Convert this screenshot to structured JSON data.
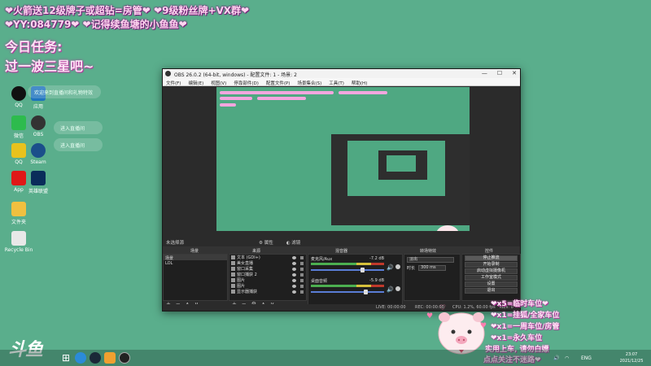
{
  "overlay": {
    "line1": "❤火箭送12级牌子或超钻=房管❤  ❤9级粉丝牌+VX群❤",
    "line2": "❤YY:084779❤  ❤记得续鱼塘的小鱼鱼❤",
    "task_title": "今日任务:",
    "task_body": "过一波三星吧~"
  },
  "desktop": {
    "icons": [
      {
        "label": "QQ",
        "color": "#111"
      },
      {
        "label": "应用",
        "color": "#1e73be"
      },
      {
        "label": "微信",
        "color": "#2dbb4d"
      },
      {
        "label": "OBS",
        "color": "#333"
      },
      {
        "label": "QQ",
        "color": "#e8c21d"
      },
      {
        "label": "Steam",
        "color": "#1b4f8a"
      },
      {
        "label": "App",
        "color": "#e01818"
      },
      {
        "label": "英雄联盟",
        "color": "#0a2c5a"
      },
      {
        "label": "文件夹",
        "color": "#f0c040"
      },
      {
        "label": "Recycle Bin",
        "color": "#e8e8e8"
      }
    ],
    "chat": [
      "欢迎来到直播间和礼物特效",
      "进入直播间",
      "进入直播间"
    ]
  },
  "obs": {
    "title": "OBS 26.0.2 (64-bit, windows) - 配置文件: 1 - 场景: 2",
    "window_controls": [
      "—",
      "☐",
      "✕"
    ],
    "menu": [
      "文件(F)",
      "编辑(E)",
      "视图(V)",
      "停靠部件(D)",
      "配置文件(P)",
      "场景集合(S)",
      "工具(T)",
      "帮助(H)"
    ],
    "no_source": "未选择源",
    "props_label": "属性",
    "filters_label": "滤镜",
    "docks": {
      "scenes": "场景",
      "sources": "来源",
      "mixer": "混音器",
      "transitions": "转场特效",
      "controls": "控件"
    },
    "scenes": [
      "场景",
      "LOL"
    ],
    "sources": [
      "文本 (GDI+)",
      "美女直播",
      "窗口采集",
      "窗口捕获 2",
      "图片",
      "图片",
      "显示器捕获"
    ],
    "mixer": [
      {
        "name": "麦克风/Aux",
        "db": "-7.2 dB",
        "vol": 0.68
      },
      {
        "name": "桌面音频",
        "db": "-5.9 dB",
        "vol": 0.72
      }
    ],
    "transition": {
      "type": "淡出",
      "duration_label": "时长",
      "duration": "300 ms"
    },
    "controls": [
      "停止推流",
      "开始录制",
      "启动虚拟摄像机",
      "工作室模式",
      "设置",
      "退出"
    ],
    "status": {
      "live": "LIVE: 00:00:00",
      "rec": "REC: 00:00:00",
      "cpu": "CPU: 1.2%, 60.00 fps",
      "kbps": "kb/s: 0"
    }
  },
  "preview": {
    "logo": "斗鱼"
  },
  "rewards": [
    "❤x5=临时车位❤",
    "❤x1=挂狐/全家车位",
    "❤x1=一周车位/房管",
    "❤x1=永久车位",
    "实用上车, 请勿白嫖",
    "点点关注不迷路❤"
  ],
  "brand": "斗鱼",
  "taskbar": {
    "apps": [
      {
        "name": "windows-icon",
        "color": "#ffffff"
      },
      {
        "name": "edge-icon",
        "color": "#2b8bd8"
      },
      {
        "name": "steam-icon",
        "color": "#1b2838"
      },
      {
        "name": "app-icon",
        "color": "#f0a030"
      },
      {
        "name": "app2-icon",
        "color": "#e04040"
      },
      {
        "name": "obs-icon",
        "color": "#222222"
      }
    ],
    "ime": "ENG",
    "time": "23:07",
    "date": "2021/12/25"
  }
}
